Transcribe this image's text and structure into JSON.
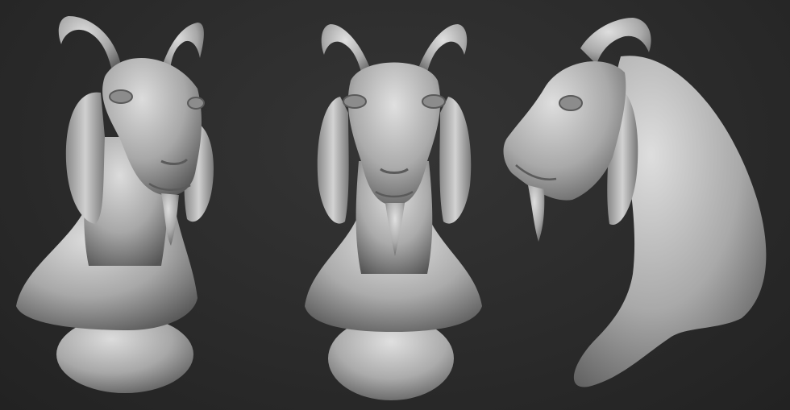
{
  "scene": {
    "subject": "goat-bust-sculpt",
    "material": "matte-clay",
    "background": "#2c2c2c",
    "clay_light": "#d8d8d8",
    "clay_mid": "#9a9a9a",
    "clay_dark": "#4a4a4a",
    "views": [
      {
        "id": "three-quarter"
      },
      {
        "id": "front"
      },
      {
        "id": "side"
      }
    ]
  }
}
